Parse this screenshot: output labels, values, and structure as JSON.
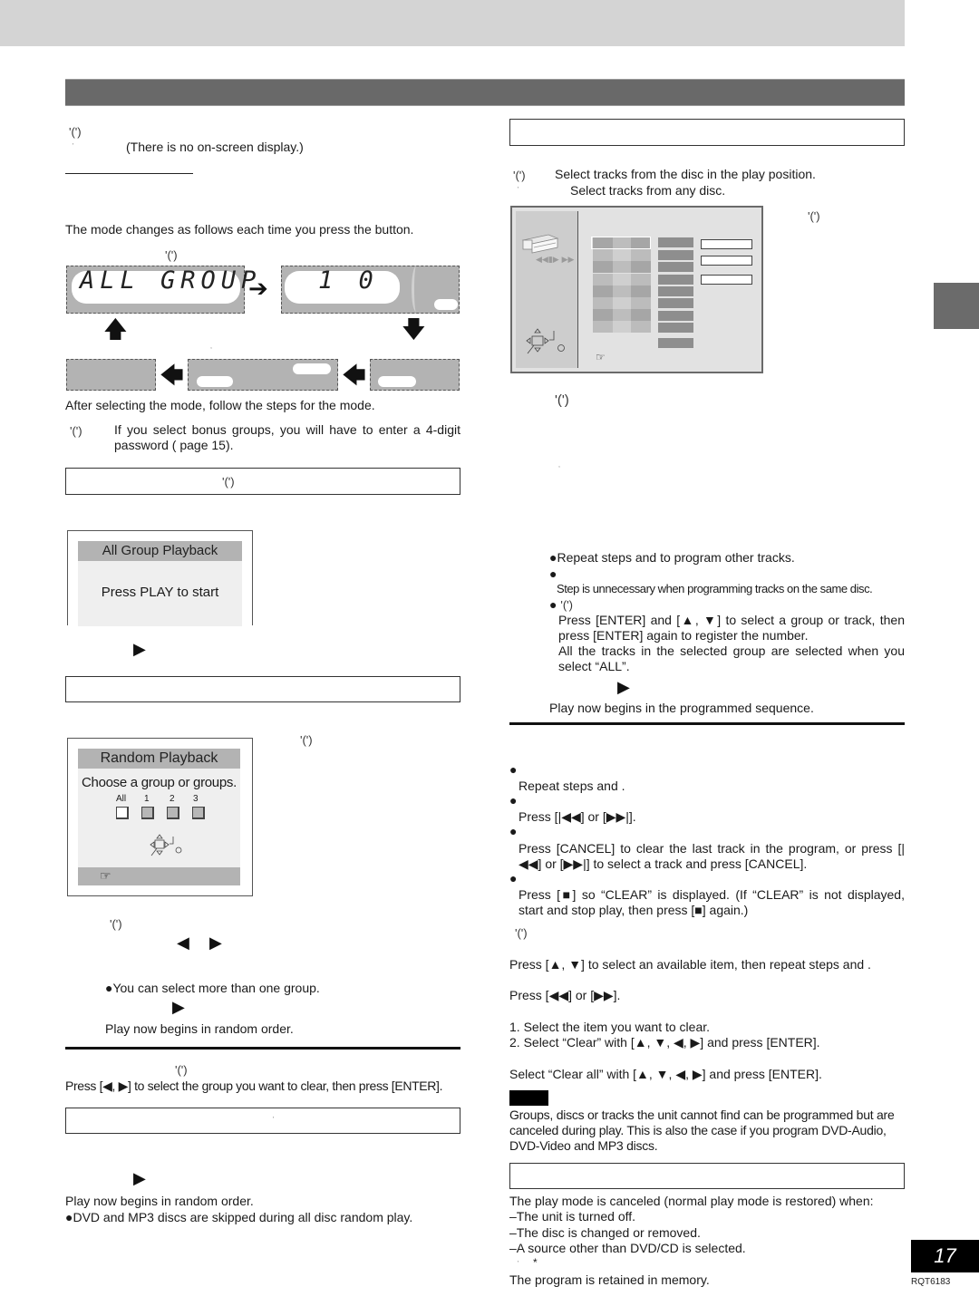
{
  "page": {
    "page_number": "17",
    "doc_code": "RQT6183"
  },
  "left": {
    "sym1": "'(')",
    "no_display": "(There is no on-screen display.)",
    "mode_changes": "The mode changes as follows each time you press the button.",
    "sym_diagram": "'(')",
    "lcd_all_group": "ALL GROUP",
    "lcd_number": "1  0",
    "after_select": "After selecting the mode, follow the steps for the mode.",
    "sym_bonus": "'(')",
    "bonus_note": "If you select bonus groups, you will have to enter a 4-digit password (   page 15).",
    "box1_sym": "'(')",
    "all_group_osd": {
      "title": "All Group Playback",
      "message": "Press PLAY to start"
    },
    "random_osd": {
      "title": "Random Playback",
      "message": "Choose  a group or groups.",
      "options": [
        "All",
        "1",
        "2",
        "3"
      ],
      "selected": "All",
      "nav_icon": "navigation-enter-icon",
      "hint_icon": "pointing-hand-icon"
    },
    "sym_random": "'(')",
    "sym_step": "'(')",
    "select_more": "You can select more than one group.",
    "play_random": "Play now begins in random order.",
    "sym_clear": "'(')",
    "clear_group": "Press [◀, ▶] to select the group you want to clear, then press [ENTER].",
    "play_random2": "Play now begins in random order.",
    "dvd_skipped": "DVD and MP3 discs are skipped during all disc random play."
  },
  "right": {
    "sym_disc": "'(')",
    "select_play_pos": "Select tracks from the disc in the play position.",
    "select_any": "Select tracks from any disc.",
    "sym_prog": "'(')",
    "sym_step": "'(')",
    "repeat_steps": "Repeat steps    and     to program other tracks.",
    "step_unnecessary": "Step    is unnecessary when programming tracks on the same disc.",
    "sym_enter": "'(')",
    "press_enter": "Press [ENTER] and [▲, ▼] to select a group or track, then press [ENTER] again to register the number.",
    "all_tracks": "All the tracks in the selected group are selected when you select “ALL”.",
    "play_programmed": "Play now begins in the programmed sequence.",
    "repeat_steps2": "Repeat steps    and   .",
    "press_skip": "Press [|◀◀] or [▶▶|].",
    "press_cancel": "Press [CANCEL] to clear the last track in the program, or press [|◀◀] or [▶▶|] to select a track and press [CANCEL].",
    "press_stop": "Press [■] so “CLEAR” is displayed. (If “CLEAR” is not displayed, start and stop play, then press [■] again.)",
    "sym_osd": "'(')",
    "press_updown": "Press [▲, ▼] to select an available item, then repeat steps    and   .",
    "press_ffrew": "Press [◀◀] or [▶▶].",
    "clear_step1": "1.  Select the item you want to clear.",
    "clear_step2": "2.  Select “Clear” with [▲, ▼, ◀, ▶] and press [ENTER].",
    "clear_all": "Select “Clear all” with [▲, ▼, ◀, ▶] and press [ENTER].",
    "note_text": "Groups, discs or tracks the unit cannot find can be programmed but are canceled during play. This is also the case if you program DVD-Audio, DVD-Video and MP3 discs.",
    "cancel_intro": "The play mode is canceled (normal play mode is restored) when:",
    "cancel_items": [
      "–The unit is turned off.",
      "–The disc is changed or removed.",
      "–A source other than DVD/CD is selected."
    ],
    "asterisk": "*",
    "retained": "The program is retained in memory."
  },
  "colors": {
    "title_bar": "#696969",
    "top_band": "#d4d4d4",
    "lcd": "#b3b3b3",
    "osd_bar": "#b3b3b3"
  }
}
